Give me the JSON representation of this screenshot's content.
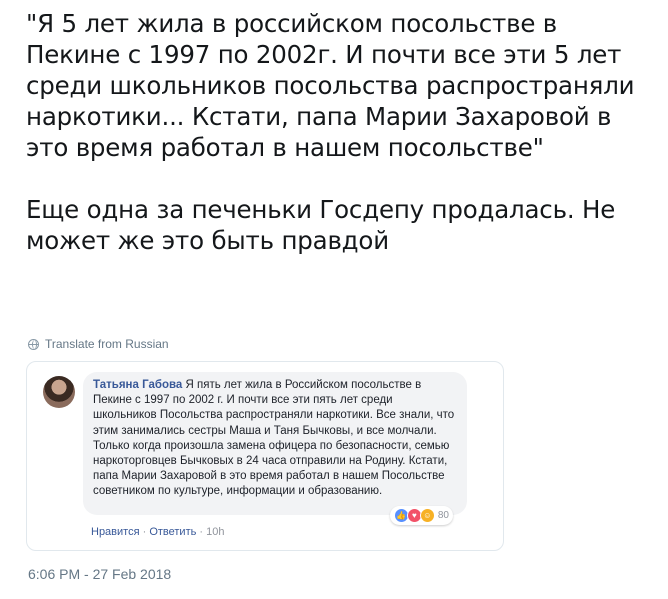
{
  "tweet": {
    "text": "\"Я 5 лет жила в российском посольстве в Пекине с 1997 по 2002г. И почти все эти 5 лет среди школьников посольства распространяли наркотики... Кстати, папа Марии Захаровой в это время работал в нашем посольстве\"\n\nЕще одна за печеньки Госдепу продалась. Не может же это быть правдой",
    "translate_label": "Translate from Russian",
    "timestamp": "6:06 PM - 27 Feb 2018"
  },
  "embedded_comment": {
    "author": "Татьяна Габова",
    "text": "Я пять лет жила в Российском посольстве в Пекине с 1997 по 2002 г. И почти все эти пять лет среди школьников Посольства распространяли наркотики. Все знали, что этим занимались сестры Маша и Таня Бычковы, и все молчали. Только когда произошла замена офицера по безопасности, семью наркоторговцев Бычковых в 24 часа отправили на Родину. Кстати, папа Марии Захаровой в это время работал в нашем Посольстве советником по культуре, информации и образованию.",
    "reaction_count": "80",
    "actions": {
      "like": "Нравится",
      "reply": "Ответить",
      "time": "10h",
      "separator": " · "
    },
    "icons": [
      "like-icon",
      "love-icon",
      "haha-icon"
    ]
  }
}
